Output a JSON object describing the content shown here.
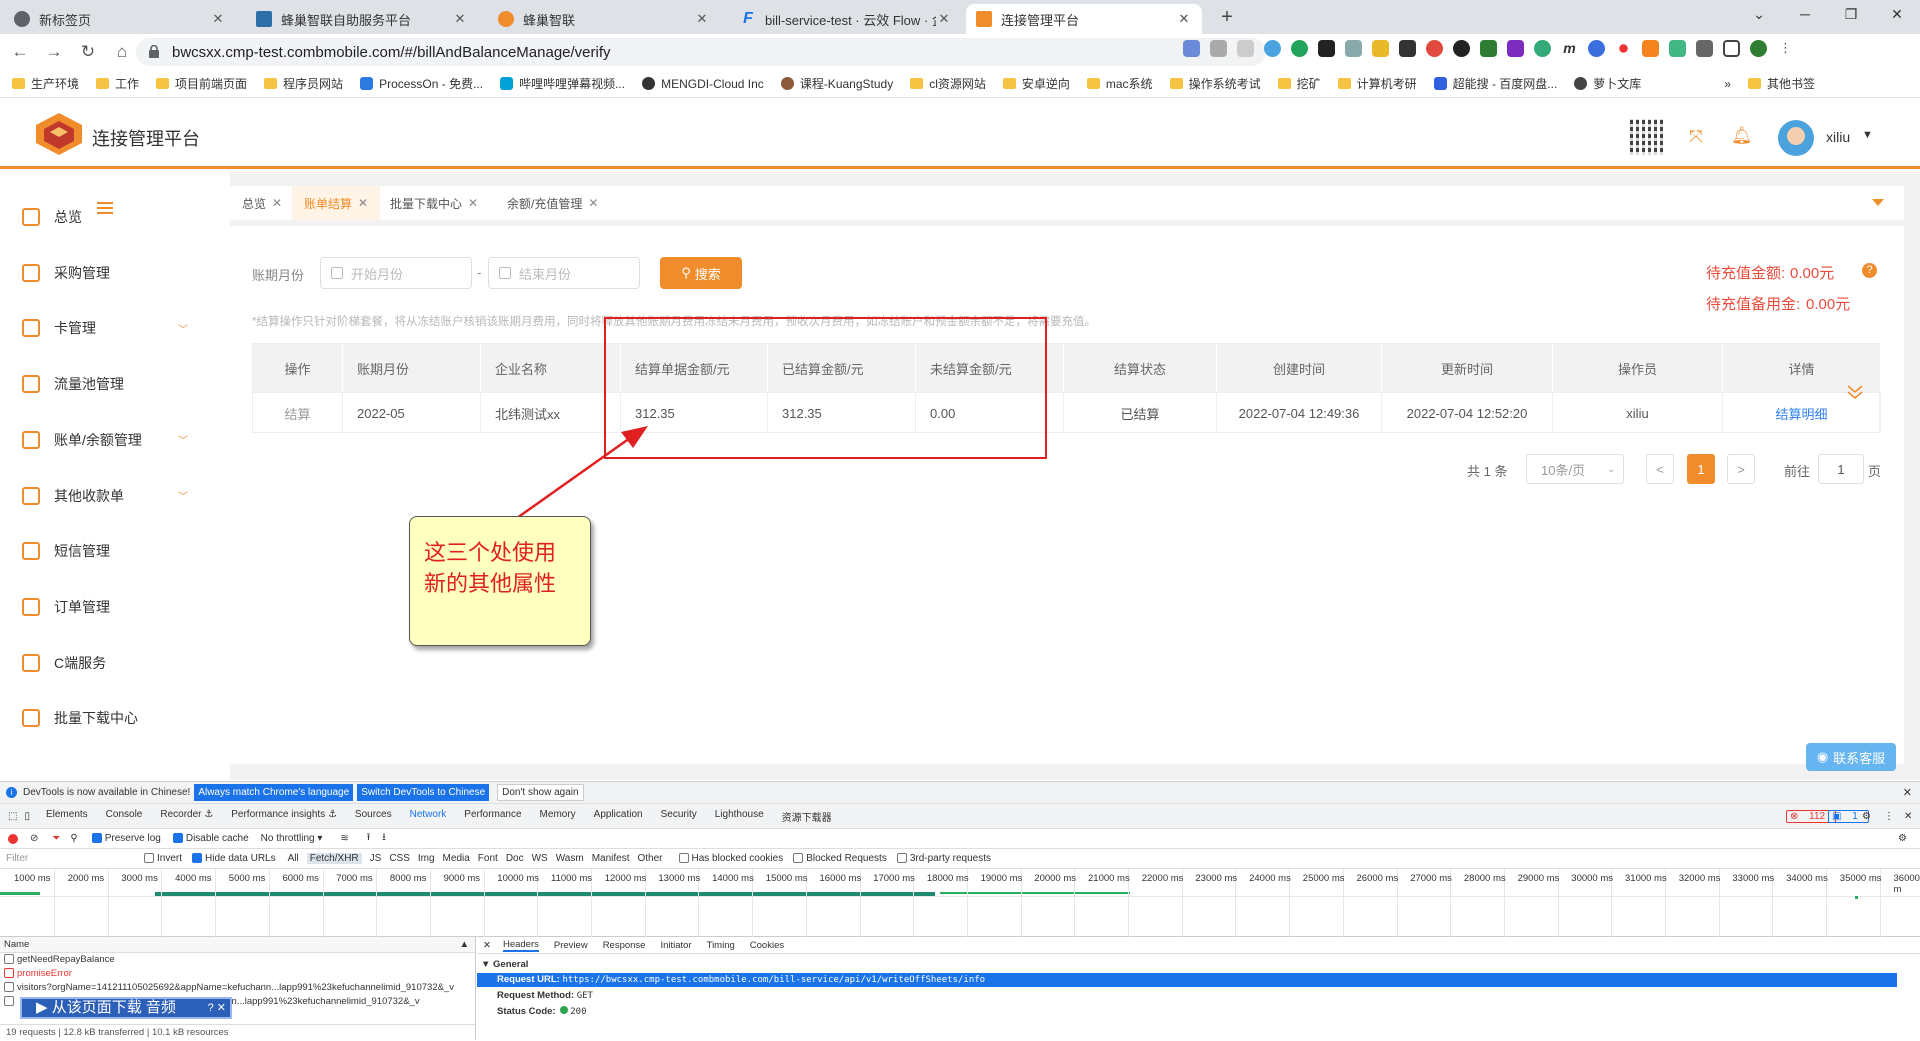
{
  "browser": {
    "tabs": [
      {
        "title": "新标签页",
        "color": "#5f6368"
      },
      {
        "title": "蜂巢智联自助服务平台",
        "color": "#2f6fa8"
      },
      {
        "title": "蜂巢智联",
        "color": "#f08c2b"
      },
      {
        "title": "bill-service-test · 云效 Flow · 企",
        "color": "#1a73e8"
      },
      {
        "title": "连接管理平台",
        "color": "#f08c2b"
      }
    ],
    "url": "bwcsxx.cmp-test.combmobile.com/#/billAndBalanceManage/verify",
    "bookmarks": [
      "生产环境",
      "工作",
      "项目前端页面",
      "程序员网站",
      "ProcessOn - 免费...",
      "哔哩哔哩弹幕视频...",
      "MENGDI-Cloud Inc",
      "课程-KuangStudy",
      "cl资源网站",
      "安卓逆向",
      "mac系统",
      "操作系统考试",
      "挖矿",
      "计算机考研",
      "超能搜 - 百度网盘...",
      "萝卜文库"
    ],
    "bookmarks_more": "»",
    "bookmarks_other": "其他书签"
  },
  "app": {
    "title": "连接管理平台",
    "user": "xiliu",
    "brand_color": "#f08c2b"
  },
  "sidebar": {
    "items": [
      {
        "label": "总览",
        "icon": "home-icon",
        "submenu": false
      },
      {
        "label": "采购管理",
        "icon": "cart-icon",
        "submenu": false
      },
      {
        "label": "卡管理",
        "icon": "sim-card-icon",
        "submenu": true
      },
      {
        "label": "流量池管理",
        "icon": "database-icon",
        "submenu": false
      },
      {
        "label": "账单/余额管理",
        "icon": "money-bag-icon",
        "submenu": true
      },
      {
        "label": "其他收款单",
        "icon": "document-icon",
        "submenu": true
      },
      {
        "label": "短信管理",
        "icon": "message-icon",
        "submenu": false
      },
      {
        "label": "订单管理",
        "icon": "order-icon",
        "submenu": false
      },
      {
        "label": "C端服务",
        "icon": "network-icon",
        "submenu": false
      },
      {
        "label": "批量下载中心",
        "icon": "download-icon",
        "submenu": false
      }
    ]
  },
  "page_tabs": [
    {
      "label": "总览",
      "active": false
    },
    {
      "label": "账单结算",
      "active": true
    },
    {
      "label": "批量下载中心",
      "active": false
    },
    {
      "label": "余额/充值管理",
      "active": false
    }
  ],
  "filters": {
    "period_label": "账期月份",
    "start_placeholder": "开始月份",
    "separator": "-",
    "end_placeholder": "结束月份",
    "search_label": "搜索"
  },
  "pending": {
    "recharge_label": "待充值金额:",
    "recharge_value": "0.00元",
    "reserve_label": "待充值备用金:",
    "reserve_value": "0.00元"
  },
  "notice": "*结算操作只针对阶梯套餐，将从冻结账户核销该账期月费用，同时将释放其他账期月费用冻结未月费用，预收次月费用，如冻结账户和预金额余额不足，将需要充值。",
  "table": {
    "headers": [
      "操作",
      "账期月份",
      "企业名称",
      "结算单据金额/元",
      "已结算金额/元",
      "未结算金额/元",
      "结算状态",
      "创建时间",
      "更新时间",
      "操作员",
      "详情"
    ],
    "rows": [
      [
        "结算",
        "2022-05",
        "北纬测试xx",
        "312.35",
        "312.35",
        "0.00",
        "已结算",
        "2022-07-04 12:49:36",
        "2022-07-04 12:52:20",
        "xiliu",
        "结算明细"
      ]
    ]
  },
  "pagination": {
    "total": "共 1 条",
    "page_size": "10条/页",
    "prev": "<",
    "current": "1",
    "next": ">",
    "goto_label": "前往",
    "goto_value": "1",
    "goto_suffix": "页"
  },
  "annotation": {
    "line1": "这三个处使用",
    "line2": "新的其他属性"
  },
  "contact_service": "联系客服",
  "devtools": {
    "info": "DevTools is now available in Chinese!",
    "btn_match": "Always match Chrome's language",
    "btn_switch": "Switch DevTools to Chinese",
    "btn_dont": "Don't show again",
    "tabs": [
      "Elements",
      "Console",
      "Recorder ⚓",
      "Performance insights ⚓",
      "Sources",
      "Network",
      "Performance",
      "Memory",
      "Application",
      "Security",
      "Lighthouse",
      "资源下载器"
    ],
    "errors": "112",
    "messages": "1",
    "preserve_log": "Preserve log",
    "disable_cache": "Disable cache",
    "throttling": "No throttling",
    "filter_placeholder": "Filter",
    "invert": "Invert",
    "hide_data": "Hide data URLs",
    "types": [
      "All",
      "Fetch/XHR",
      "JS",
      "CSS",
      "Img",
      "Media",
      "Font",
      "Doc",
      "WS",
      "Wasm",
      "Manifest",
      "Other"
    ],
    "has_blocked": "Has blocked cookies",
    "blocked_requests": "Blocked Requests",
    "third_party": "3rd-party requests",
    "ticks": [
      "1000 ms",
      "2000 ms",
      "3000 ms",
      "4000 ms",
      "5000 ms",
      "6000 ms",
      "7000 ms",
      "8000 ms",
      "9000 ms",
      "10000 ms",
      "11000 ms",
      "12000 ms",
      "13000 ms",
      "14000 ms",
      "15000 ms",
      "16000 ms",
      "17000 ms",
      "18000 ms",
      "19000 ms",
      "20000 ms",
      "21000 ms",
      "22000 ms",
      "23000 ms",
      "24000 ms",
      "25000 ms",
      "26000 ms",
      "27000 ms",
      "28000 ms",
      "29000 ms",
      "30000 ms",
      "31000 ms",
      "32000 ms",
      "33000 ms",
      "34000 ms",
      "35000 ms",
      "36000 m"
    ],
    "list_header": "Name",
    "requests": [
      "getNeedRepayBalance",
      "promiseError",
      "visitors?orgName=141211105025692&appName=kefuchann...lapp991%23kefuchannelimid_910732&_v",
      "kefuchann...lapp991%23kefuchannelimid_910732&_v"
    ],
    "download_overlay": "从该页面下载 音频",
    "summary": [
      "19 requests",
      "12.8 kB transferred",
      "10.1 kB resources"
    ],
    "detail_tabs": [
      "Headers",
      "Preview",
      "Response",
      "Initiator",
      "Timing",
      "Cookies"
    ],
    "general": "General",
    "request_url_label": "Request URL:",
    "request_url": "https://bwcsxx.cmp-test.combmobile.com/bill-service/api/v1/writeOffSheets/info",
    "method_label": "Request Method:",
    "method": "GET",
    "status_label": "Status Code:",
    "status": "200"
  }
}
